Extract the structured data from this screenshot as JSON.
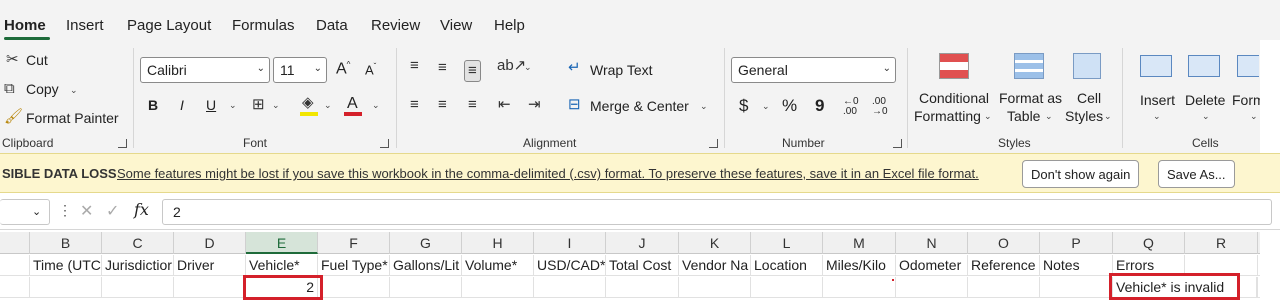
{
  "menu": {
    "tabs": [
      "Home",
      "Insert",
      "Page Layout",
      "Formulas",
      "Data",
      "Review",
      "View",
      "Help"
    ]
  },
  "clipboard": {
    "cut": "Cut",
    "copy": "Copy",
    "format_painter": "Format Painter",
    "group": "Clipboard"
  },
  "font": {
    "name": "Calibri",
    "size": "11",
    "bold": "B",
    "italic": "I",
    "underline": "U",
    "font_color_glyph": "A",
    "grow": "A",
    "shrink": "A",
    "group": "Font"
  },
  "alignment": {
    "wrap_text": "Wrap Text",
    "merge_center": "Merge & Center",
    "group": "Alignment"
  },
  "number": {
    "format": "General",
    "currency": "$",
    "percent": "%",
    "comma": "9",
    "inc_decimal": "←0 .00",
    "dec_decimal": ".00 →0",
    "group": "Number"
  },
  "styles": {
    "conditional": [
      "Conditional",
      "Formatting"
    ],
    "format_as_table": [
      "Format as",
      "Table"
    ],
    "cell_styles": [
      "Cell",
      "Styles"
    ],
    "group": "Styles"
  },
  "cells": {
    "insert": "Insert",
    "delete": "Delete",
    "format": "Form",
    "group": "Cells"
  },
  "warning": {
    "title": "SIBLE DATA LOSS",
    "message": "Some features might be lost if you save this workbook in the comma-delimited (.csv) format. To preserve these features, save it in an Excel file format.",
    "dont_show": "Don't show again",
    "save_as": "Save As..."
  },
  "formula_bar": {
    "fx": "fx",
    "value": "2"
  },
  "grid": {
    "columns": [
      "B",
      "C",
      "D",
      "E",
      "F",
      "G",
      "H",
      "I",
      "J",
      "K",
      "L",
      "M",
      "N",
      "O",
      "P",
      "Q",
      "R"
    ],
    "selected_column": "E",
    "header_row": [
      "Time (UTC",
      "Jurisdictior",
      "Driver",
      "Vehicle*",
      "Fuel Type*",
      "Gallons/Lit",
      "Volume*",
      "USD/CAD*",
      "Total Cost",
      "Vendor Na",
      "Location",
      "Miles/Kilo",
      "Odometer",
      "Reference",
      "Notes",
      "Errors",
      ""
    ],
    "data_row": [
      "",
      "",
      "",
      "2",
      "",
      "",
      "",
      "",
      "",
      "",
      "",
      "",
      "",
      "",
      "",
      "Vehicle* is invalid",
      ""
    ]
  },
  "colors": {
    "accent": "#1e6b3a",
    "error_outline": "#d4202a",
    "warning_bg": "#fdf6cf"
  }
}
